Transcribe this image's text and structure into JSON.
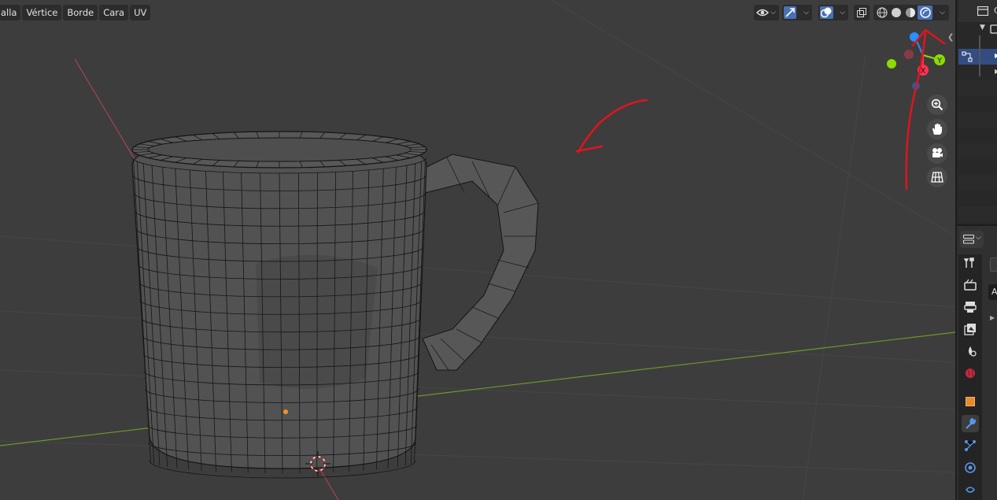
{
  "header": {
    "menus": [
      {
        "id": "mesh",
        "label": "alla"
      },
      {
        "id": "vertex",
        "label": "Vértice"
      },
      {
        "id": "edge",
        "label": "Borde"
      },
      {
        "id": "face",
        "label": "Cara"
      },
      {
        "id": "uv",
        "label": "UV"
      }
    ],
    "tools": [
      {
        "name": "visibility-icon",
        "active": false
      },
      {
        "name": "snap-icon",
        "active": true
      },
      {
        "name": "overlays-icon",
        "active": true
      },
      {
        "name": "xray-icon",
        "active": false
      },
      {
        "name": "shading-wireframe-icon",
        "active": false
      },
      {
        "name": "shading-solid-icon",
        "active": false
      },
      {
        "name": "shading-material-icon",
        "active": false
      },
      {
        "name": "shading-rendered-icon",
        "active": true
      }
    ]
  },
  "gizmo": {
    "x_label": "X",
    "y_label": "Y",
    "x_color": "#ff3352",
    "y_color": "#8bdc00",
    "z_color": "#2890ff"
  },
  "navigation": [
    "zoom-icon",
    "hand-pan-icon",
    "camera-icon",
    "grid-ortho-icon"
  ],
  "outliner": {
    "header_label": "C",
    "rows": [
      "scene-collection",
      "object-selected",
      "object"
    ]
  },
  "properties": {
    "tabs": [
      "tool-icon",
      "render-icon",
      "output-icon",
      "view-layer-icon",
      "scene-icon",
      "world-icon",
      "object-icon",
      "modifier-icon",
      "particles-icon",
      "physics-icon",
      "constraints-icon"
    ],
    "active_tab": "modifier-icon",
    "field_letter": "A"
  },
  "colors": {
    "viewport_bg": "#3d3d3d",
    "annotation": "#e0141e",
    "active_blue": "#4772b3",
    "x_axis": "#b04a52",
    "y_axis": "#6e9a2a"
  }
}
